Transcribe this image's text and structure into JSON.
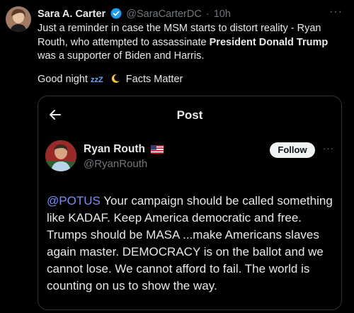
{
  "tweet": {
    "author_name": "Sara A. Carter",
    "author_handle": "@SaraCarterDC",
    "separator": "·",
    "time": "10h",
    "text_part1": "Just a reminder in case the MSM starts to distort reality - Ryan Routh, who attempted to assassinate ",
    "text_bold": "President Donald Trump",
    "text_part2": " was a supporter of Biden and Harris.",
    "goodnight_text": "Good night",
    "zzz": "zzZ",
    "facts_matter": "Facts Matter",
    "more": "···"
  },
  "embed": {
    "title": "Post",
    "name": "Ryan Routh",
    "handle": "@RyanRouth",
    "follow_label": "Follow",
    "more": "···",
    "mention": "@POTUS",
    "text": " Your campaign should be called something like KADAF. Keep America democratic and free. Trumps should be MASA ...make Americans slaves again master. DEMOCRACY is on the ballot and we cannot lose. We cannot afford to fail. The world is counting on us to show the way."
  },
  "icons": {
    "verified": "verified-badge-icon",
    "flag": "us-flag-icon",
    "moon": "crescent-moon-icon",
    "back": "back-arrow-icon",
    "sleep": "zzz-sleep-icon"
  },
  "colors": {
    "background": "#000000",
    "text": "#e7e9ea",
    "secondary_text": "#71767b",
    "verified": "#1d9bf0",
    "mention": "#7c8cff",
    "follow_bg": "#eff3f4"
  }
}
